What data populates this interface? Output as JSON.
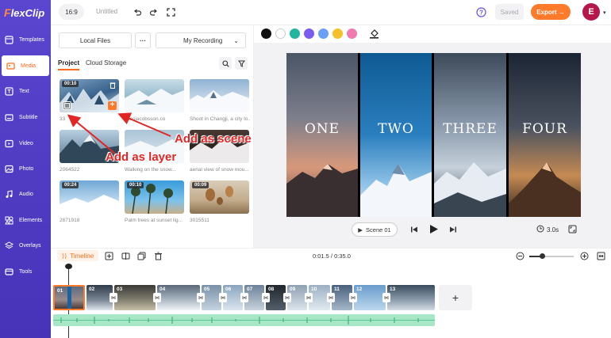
{
  "app": {
    "logo_a": "F",
    "logo_b": "lexClip"
  },
  "sidebar": {
    "items": [
      {
        "label": "Templates",
        "icon": "templates-icon"
      },
      {
        "label": "Media",
        "icon": "media-icon"
      },
      {
        "label": "Text",
        "icon": "text-icon"
      },
      {
        "label": "Subtitle",
        "icon": "subtitle-icon"
      },
      {
        "label": "Video",
        "icon": "video-icon"
      },
      {
        "label": "Photo",
        "icon": "photo-icon"
      },
      {
        "label": "Audio",
        "icon": "audio-icon"
      },
      {
        "label": "Elements",
        "icon": "elements-icon"
      },
      {
        "label": "Overlays",
        "icon": "overlays-icon"
      },
      {
        "label": "Tools",
        "icon": "tools-icon"
      }
    ]
  },
  "topbar": {
    "ratio": "16:9",
    "title": "Untitled",
    "saved": "Saved",
    "export": "Export →",
    "avatar": "E"
  },
  "media": {
    "local_files": "Local Files",
    "more": "···",
    "recording": "My Recording",
    "tabs": [
      "Project",
      "Cloud Storage"
    ],
    "items": [
      {
        "duration": "00:10",
        "caption": "33"
      },
      {
        "duration": "",
        "caption": "ksasjacobsson.co"
      },
      {
        "duration": "",
        "caption": "Shoot in Changji, a city lo..."
      },
      {
        "duration": "",
        "caption": "2064522"
      },
      {
        "duration": "",
        "caption": "Walking on the snow..."
      },
      {
        "duration": "",
        "caption": "aerial view of snow mou..."
      },
      {
        "duration": "00:24",
        "caption": "2871918"
      },
      {
        "duration": "00:10",
        "caption": "Palm trees at sunset lig..."
      },
      {
        "duration": "00:09",
        "caption": "3015511"
      }
    ]
  },
  "callouts": {
    "scene": "Add as scene",
    "layer": "Add as layer"
  },
  "colors": [
    "#111111",
    "#ffffff",
    "#22b5a0",
    "#7b5cf0",
    "#6aa0f5",
    "#f5c02a",
    "#f07bb0"
  ],
  "preview": {
    "panels": [
      "ONE",
      "TWO",
      "THREE",
      "FOUR"
    ]
  },
  "controls": {
    "scene": "Scene 01",
    "duration": "3.0s"
  },
  "timeline": {
    "label": "Timeline",
    "time": "0:01.5 / 0:35.0",
    "clips": [
      "01",
      "02",
      "03",
      "04",
      "05",
      "06",
      "07",
      "08",
      "09",
      "10",
      "11",
      "12",
      "13"
    ]
  }
}
